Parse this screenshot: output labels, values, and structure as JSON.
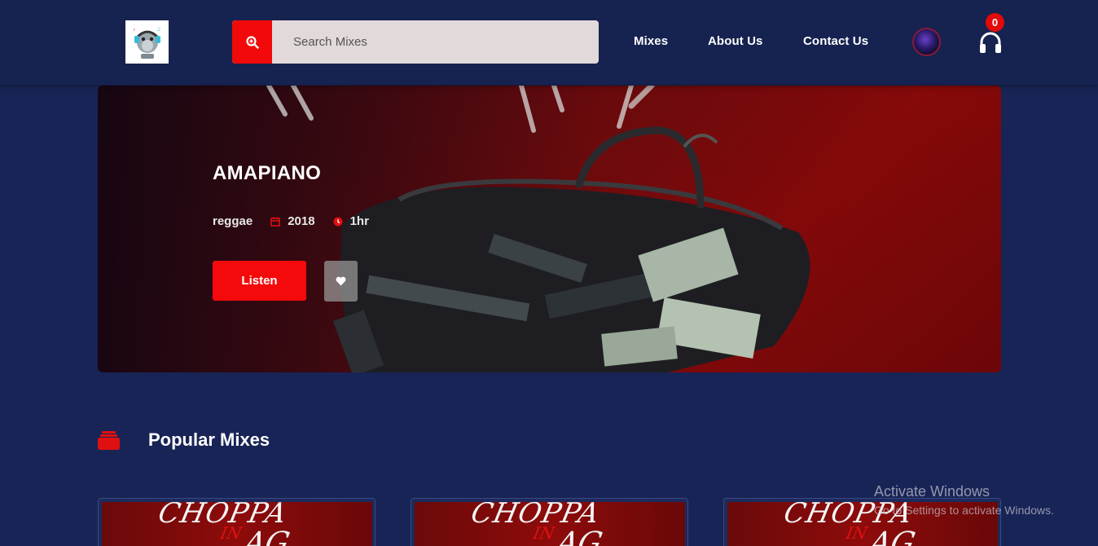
{
  "header": {
    "logo_icon": "hippo-dj-logo-icon",
    "search": {
      "placeholder": "Search Mixes",
      "icon": "search-zoom-icon"
    },
    "nav": [
      "Mixes",
      "About Us",
      "Contact Us"
    ],
    "avatar_icon": "user-avatar",
    "cart": {
      "icon": "headphones-icon",
      "count": "0"
    }
  },
  "hero": {
    "title": "AMAPIANO",
    "genre": "reggae",
    "year": "2018",
    "duration": "1hr",
    "listen_label": "Listen",
    "favorite_icon": "heart-icon"
  },
  "popular": {
    "icon": "stack-icon",
    "title": "Popular Mixes",
    "cards": [
      {
        "art_text": "CHOPPA",
        "art_sub": "IN",
        "art_tail": "AG"
      },
      {
        "art_text": "CHOPPA",
        "art_sub": "IN",
        "art_tail": "AG"
      },
      {
        "art_text": "CHOPPA",
        "art_sub": "IN",
        "art_tail": "AG"
      }
    ]
  },
  "watermark": {
    "title": "Activate Windows",
    "subtitle": "Go to Settings to activate Windows."
  },
  "colors": {
    "background": "#182456",
    "accent": "#f20a0a",
    "search_bg": "#e2d9da"
  }
}
